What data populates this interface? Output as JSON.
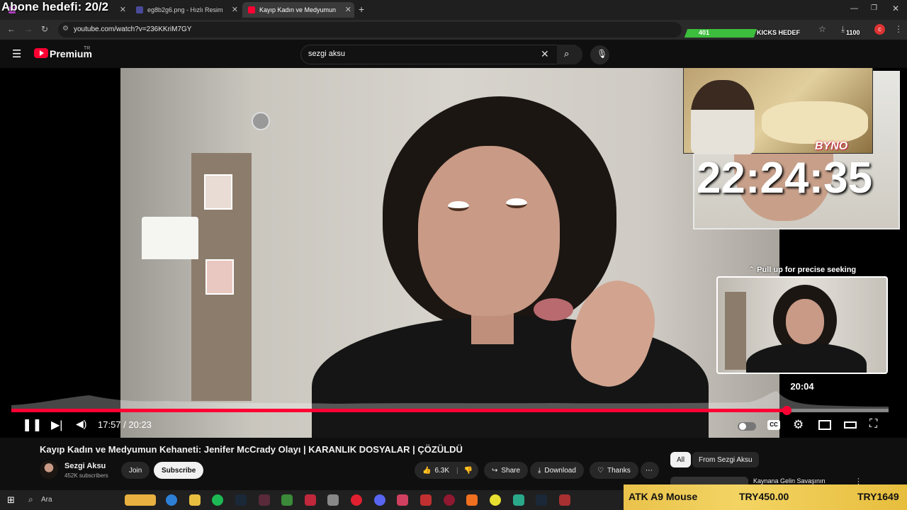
{
  "overlay": {
    "title": "Abone hedefi: 20/2",
    "kicks_count": "401",
    "kicks_label": "KICKS HEDEF",
    "kicks_goal": "1100",
    "timer": "22:24:35",
    "watermark": "BYNO"
  },
  "browser": {
    "tabs": [
      {
        "label": ""
      },
      {
        "label": "eg8b2g6.png - Hızlı Resim"
      },
      {
        "label": "Kayıp Kadın ve Medyumun"
      }
    ],
    "url": "youtube.com/watch?v=236KKriM7GY"
  },
  "youtube": {
    "logo_text": "Premium",
    "region": "TR",
    "search_value": "sezgi aksu"
  },
  "player": {
    "current_time": "17:57 / 20:23",
    "progress_fraction": 0.884,
    "seek_hint": "Pull up for precise seeking",
    "preview_time": "20:04"
  },
  "video": {
    "title": "Kayıp Kadın ve Medyumun Kehaneti: Jenifer McCrady Olayı | KARANLIK DOSYALAR | ÇÖZÜLDÜ",
    "channel": "Sezgi Aksu",
    "subscribers": "452K subscribers",
    "join_label": "Join",
    "subscribe_label": "Subscribe",
    "likes": "6.3K",
    "share_label": "Share",
    "download_label": "Download",
    "thanks_label": "Thanks"
  },
  "sidebar": {
    "chips": [
      "All",
      "From Sezgi Aksu"
    ],
    "next_video": "Kaynana Gelin Savaşının"
  },
  "taskbar": {
    "search_label": "Ara"
  },
  "ad": {
    "product": "ATK A9 Mouse",
    "price1": "TRY450.00",
    "price2": "TRY1649"
  },
  "colors": {
    "accent": "#ff0033",
    "kicks_bar": "#3dbd3d"
  }
}
